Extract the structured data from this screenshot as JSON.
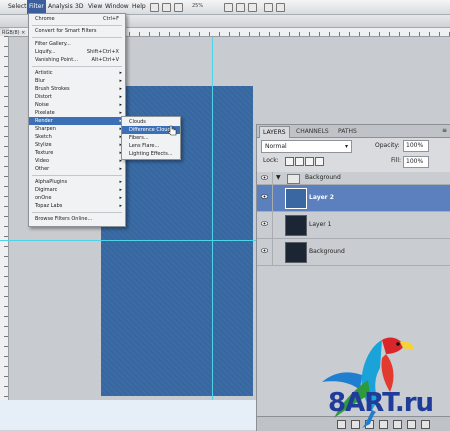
{
  "menubar": {
    "items": [
      "Select",
      "Filter",
      "Analysis",
      "3D",
      "View",
      "Window",
      "Help"
    ],
    "active": "Filter",
    "zoom": "25%"
  },
  "document": {
    "tab_label": "RGB/8) ×"
  },
  "filter_menu": {
    "items": [
      {
        "label": "Chrome",
        "shortcut": "Ctrl+F"
      },
      {
        "label": "Convert for Smart Filters"
      },
      {
        "label": "Filter Gallery..."
      },
      {
        "label": "Liquify...",
        "shortcut": "Shift+Ctrl+X"
      },
      {
        "label": "Vanishing Point...",
        "shortcut": "Alt+Ctrl+V"
      },
      {
        "label": "Artistic",
        "submenu": true
      },
      {
        "label": "Blur",
        "submenu": true
      },
      {
        "label": "Brush Strokes",
        "submenu": true
      },
      {
        "label": "Distort",
        "submenu": true
      },
      {
        "label": "Noise",
        "submenu": true
      },
      {
        "label": "Pixelate",
        "submenu": true
      },
      {
        "label": "Render",
        "submenu": true,
        "highlighted": true
      },
      {
        "label": "Sharpen",
        "submenu": true
      },
      {
        "label": "Sketch",
        "submenu": true
      },
      {
        "label": "Stylize",
        "submenu": true
      },
      {
        "label": "Texture",
        "submenu": true
      },
      {
        "label": "Video",
        "submenu": true
      },
      {
        "label": "Other",
        "submenu": true
      },
      {
        "label": "AlphaPlugins",
        "submenu": true
      },
      {
        "label": "Digimarc",
        "submenu": true
      },
      {
        "label": "onOne",
        "submenu": true
      },
      {
        "label": "Topaz Labs",
        "submenu": true
      },
      {
        "label": "Browse Filters Online..."
      }
    ]
  },
  "render_submenu": {
    "items": [
      {
        "label": "Clouds"
      },
      {
        "label": "Difference Clouds",
        "highlighted": true
      },
      {
        "label": "Fibers..."
      },
      {
        "label": "Lens Flare..."
      },
      {
        "label": "Lighting Effects..."
      }
    ]
  },
  "layers_panel": {
    "tabs": [
      "LAYERS",
      "CHANNELS",
      "PATHS"
    ],
    "active_tab": "LAYERS",
    "blend_mode": "Normal",
    "opacity_label": "Opacity:",
    "opacity_value": "100%",
    "lock_label": "Lock:",
    "fill_label": "Fill:",
    "fill_value": "100%",
    "group": {
      "name": "Background"
    },
    "layers": [
      {
        "name": "Layer 2",
        "selected": true,
        "thumb": "blue"
      },
      {
        "name": "Layer 1",
        "selected": false,
        "thumb": "dark"
      },
      {
        "name": "Background",
        "selected": false,
        "thumb": "dark"
      }
    ]
  },
  "watermark": {
    "text": "8ART.ru"
  },
  "colors": {
    "document_fill": "#3667a0",
    "selection_blue": "#3b6fb6",
    "guide": "#4fd3e8"
  }
}
